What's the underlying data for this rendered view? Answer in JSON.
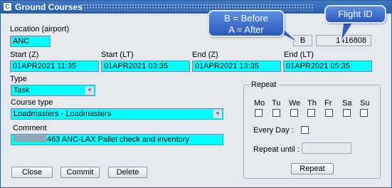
{
  "window": {
    "title": "Ground Courses",
    "app_icon": "C"
  },
  "location": {
    "label": "Location (airport)",
    "value": "ANC"
  },
  "b_box": {
    "value": "B"
  },
  "flight_id": {
    "value": "1416808"
  },
  "start_z": {
    "label": "Start (Z)",
    "value": "01APR2021 11:35"
  },
  "start_lt": {
    "label": "Start (LT)",
    "value": "01APR2021 03:35"
  },
  "end_z": {
    "label": "End (Z)",
    "value": "01APR2021 13:35"
  },
  "end_lt": {
    "label": "End (LT)",
    "value": "01APR2021 05:35"
  },
  "type": {
    "label": "Type",
    "value": "Task"
  },
  "course_type": {
    "label": "Course type",
    "value": "Loadmasters - Loadmasters"
  },
  "comment": {
    "label": "Comment",
    "value": "463 ANC-LAX Pallet check and inventory"
  },
  "buttons": {
    "close": "Close",
    "commit": "Commit",
    "delete": "Delete"
  },
  "repeat": {
    "legend": "Repeat",
    "days": [
      "Mo",
      "Tu",
      "We",
      "Th",
      "Fr",
      "Sa",
      "Su"
    ],
    "every_day_label": "Every Day :",
    "repeat_until_label": "Repeat until :",
    "repeat_until_value": "",
    "button": "Repeat"
  },
  "annotations": {
    "before_after": [
      "B = Before",
      "A = After"
    ],
    "flight_id": "Flight ID"
  },
  "colors": {
    "field_bg": "#00ffff",
    "titlebar": "#2a5ea7",
    "callout": "#3b6fd0",
    "window_bg": "#e6e9ee"
  }
}
